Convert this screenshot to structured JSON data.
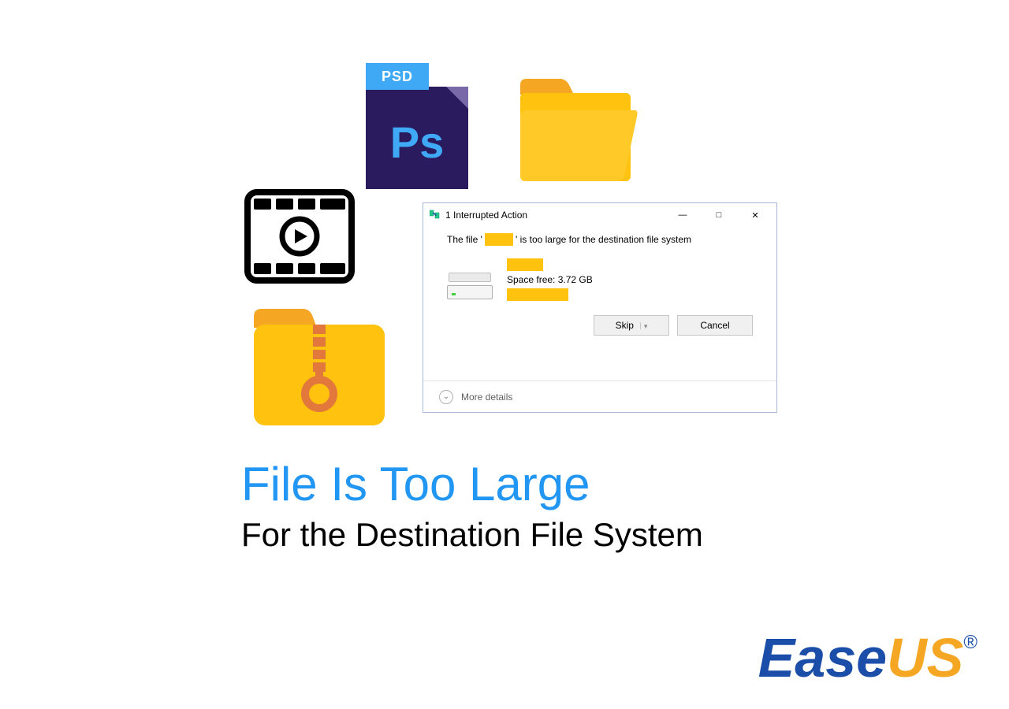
{
  "psd": {
    "badge": "PSD",
    "text": "Ps"
  },
  "dialog": {
    "title": "1 Interrupted Action",
    "minimize": "—",
    "maximize": "□",
    "close": "✕",
    "msg_prefix": "The file '",
    "msg_suffix": "' is too large for the destination file system",
    "space_free": "Space free: 3.72 GB",
    "skip": "Skip",
    "cancel": "Cancel",
    "more": "More details"
  },
  "headline": {
    "title": "File Is Too Large",
    "subtitle": "For the Destination File System"
  },
  "logo": {
    "part1": "Ease",
    "part2": "US",
    "reg": "®"
  }
}
